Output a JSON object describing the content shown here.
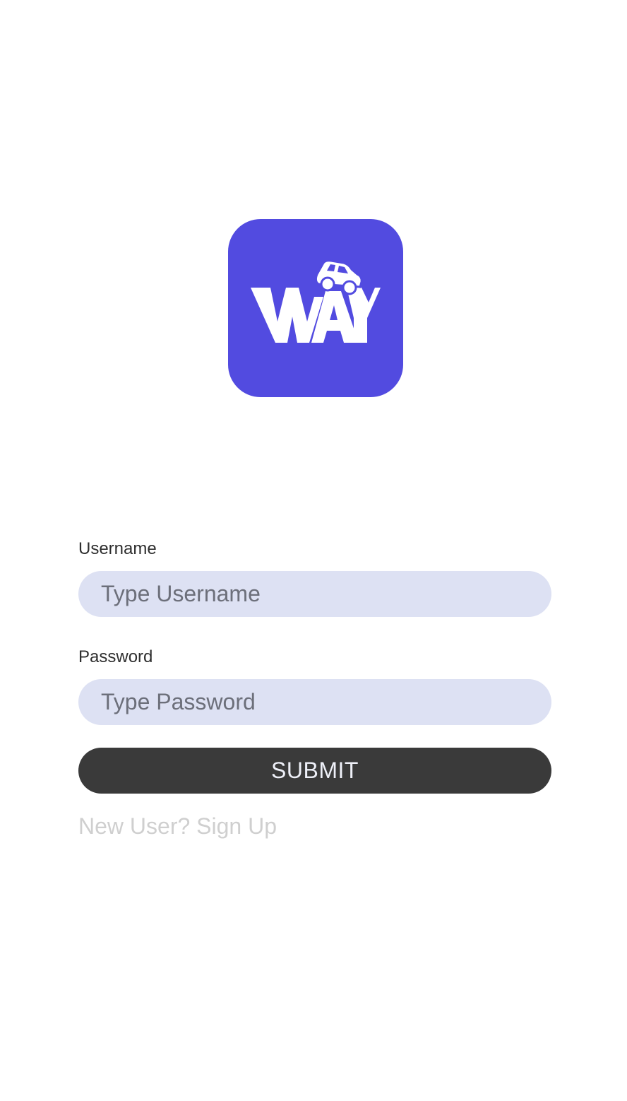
{
  "logo": {
    "alt": "WAY",
    "background_color": "#524be0",
    "glyph_color": "#ffffff",
    "icon": "car-icon"
  },
  "form": {
    "username_label": "Username",
    "username_placeholder": "Type Username",
    "username_value": "",
    "password_label": "Password",
    "password_placeholder": "Type Password",
    "password_value": "",
    "submit_label": "SUBMIT",
    "signup_link": "New User? Sign Up"
  },
  "colors": {
    "input_background": "#dde1f3",
    "button_background": "#3a3a3a",
    "link_color": "#cfcfcf"
  }
}
